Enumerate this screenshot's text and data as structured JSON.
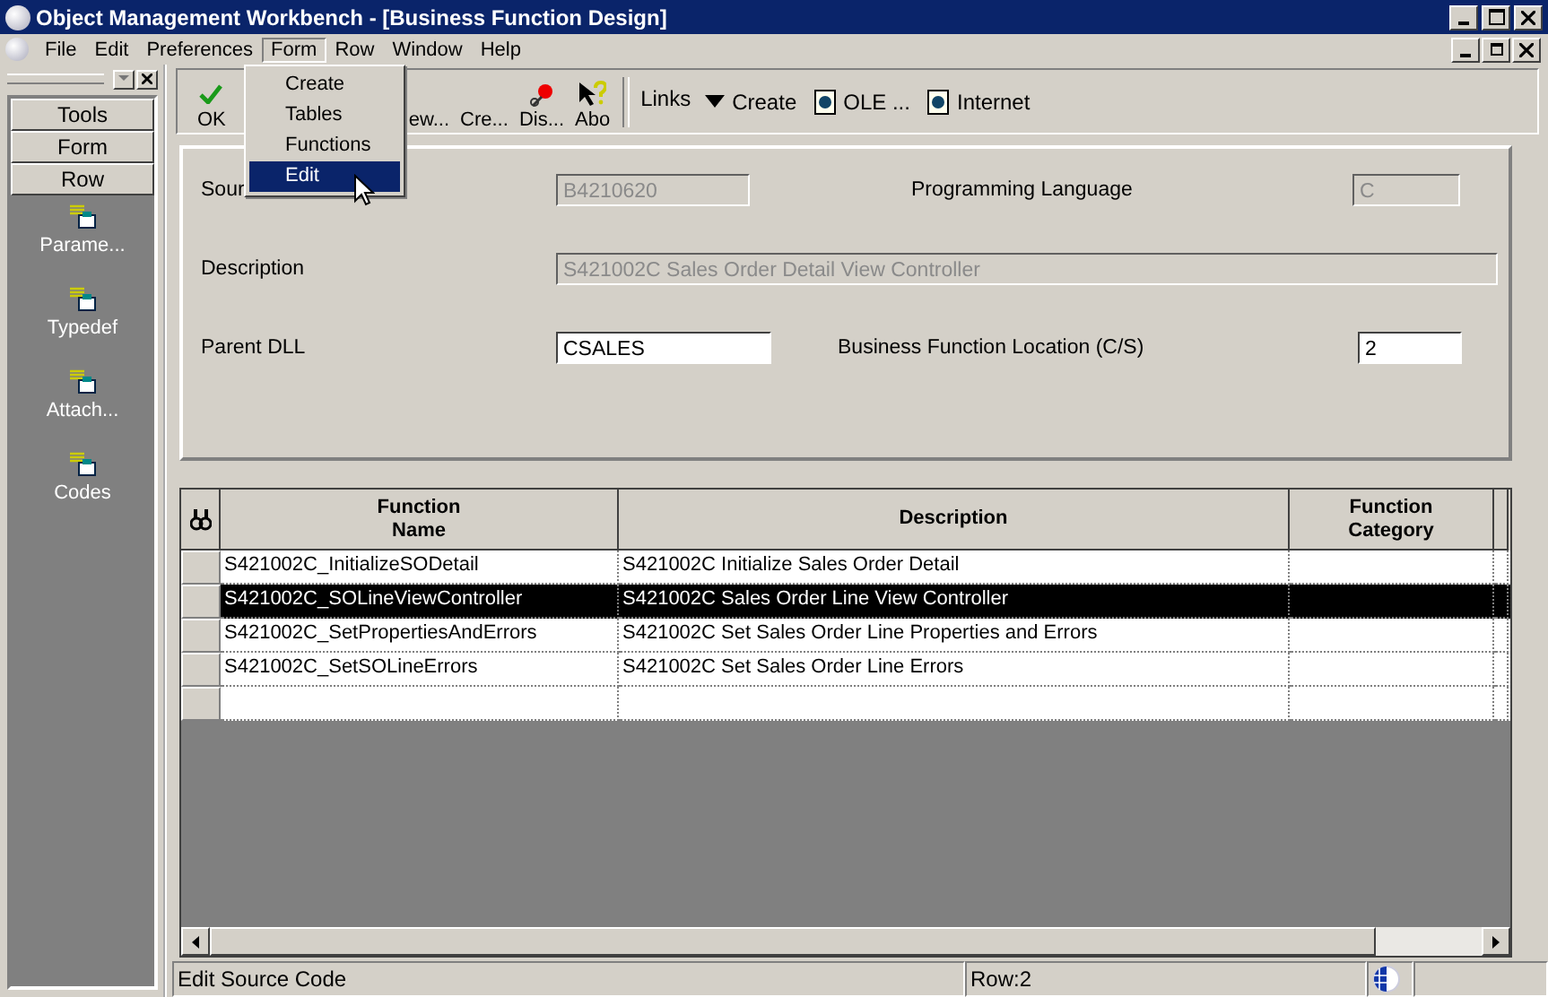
{
  "window": {
    "title": "Object Management Workbench - [Business Function Design]"
  },
  "menu_bar": [
    {
      "label": "File",
      "selected": false
    },
    {
      "label": "Edit",
      "selected": false
    },
    {
      "label": "Preferences",
      "selected": false
    },
    {
      "label": "Form",
      "selected": true
    },
    {
      "label": "Row",
      "selected": false
    },
    {
      "label": "Window",
      "selected": false
    },
    {
      "label": "Help",
      "selected": false
    }
  ],
  "form_menu": [
    {
      "label": "Create",
      "selected": false
    },
    {
      "label": "Tables",
      "selected": false
    },
    {
      "label": "Functions",
      "selected": false
    },
    {
      "label": "Edit",
      "selected": true
    }
  ],
  "side_panel": {
    "tabs": [
      "Tools",
      "Form",
      "Row"
    ],
    "items": [
      "Parame...",
      "Typedef",
      "Attach...",
      "Codes"
    ]
  },
  "toolbar": [
    {
      "kind": "check",
      "label": "OK"
    },
    {
      "kind": "hidden",
      "label": "ew..."
    },
    {
      "kind": "plain",
      "label": "Cre..."
    },
    {
      "kind": "pin",
      "label": "Dis..."
    },
    {
      "kind": "help",
      "label": "Abo"
    }
  ],
  "links": {
    "label": "Links",
    "items": [
      {
        "kind": "triangle",
        "label": "Create"
      },
      {
        "kind": "doc",
        "label": "OLE ..."
      },
      {
        "kind": "doc",
        "label": "Internet"
      }
    ]
  },
  "form": {
    "source": {
      "label": "Sour",
      "value": "B4210620",
      "disabled": true
    },
    "programming_language": {
      "label": "Programming Language",
      "value": "C",
      "disabled": true
    },
    "description": {
      "label": "Description",
      "value": "S421002C Sales Order Detail View Controller",
      "disabled": true
    },
    "parent_dll": {
      "label": "Parent DLL",
      "value": "CSALES",
      "disabled": false
    },
    "location": {
      "label": "Business Function Location (C/S)",
      "value": "2",
      "disabled": false
    }
  },
  "table": {
    "columns": [
      "Function\nName",
      "Description",
      "Function\nCategory"
    ],
    "rows": [
      {
        "cells": [
          "S421002C_InitializeSODetail",
          "S421002C Initialize Sales Order Detail",
          ""
        ],
        "selected": false
      },
      {
        "cells": [
          "S421002C_SOLineViewController",
          "S421002C Sales Order Line View Controller",
          ""
        ],
        "selected": true
      },
      {
        "cells": [
          "S421002C_SetPropertiesAndErrors",
          "S421002C Set Sales Order Line Properties and Errors",
          ""
        ],
        "selected": false
      },
      {
        "cells": [
          "S421002C_SetSOLineErrors",
          "S421002C Set Sales Order Line Errors",
          ""
        ],
        "selected": false
      }
    ]
  },
  "status_bar": {
    "message": "Edit Source Code",
    "row": "Row:2"
  }
}
